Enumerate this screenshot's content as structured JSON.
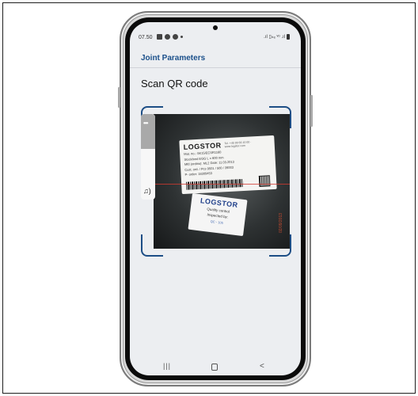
{
  "status_bar": {
    "time": "07.50",
    "signal_text": ".ıl ▯ₗₜₑ ᵛᵒ .ıl"
  },
  "app_bar": {
    "title": "Joint Parameters"
  },
  "page": {
    "heading": "Scan QR code"
  },
  "camera_feed": {
    "label_brand": "LOGSTOR",
    "label_header_extra": "Tel. +45 99 66 10 00 · www.logstor.com",
    "label_rows": [
      "Mat. no.:        SK15/ECSR1160",
      "Stockfond EGG L = 600 mm",
      "Mfd (ordino):    ML2    Date: 11.03.2013",
      "Cust. ord. / Pcs  9501 / 500 / 39003",
      "P- order:        18309453"
    ],
    "qc_brand": "LOGSTOR",
    "qc_text": "Quality control",
    "qc_inspected": "Inspected by:",
    "qc_stamp": "QC - 105",
    "side_text": "02/09/2013"
  },
  "side_panel": {
    "more_glyph": "•••",
    "sound_glyph": "♫)"
  },
  "nav_bar": {
    "recents_glyph": "|||",
    "back_glyph": "<"
  },
  "colors": {
    "accent": "#1d4e86",
    "app_title": "#1a4f8a",
    "screen_bg": "#eceef1",
    "scan_line": "#d23a2f"
  }
}
